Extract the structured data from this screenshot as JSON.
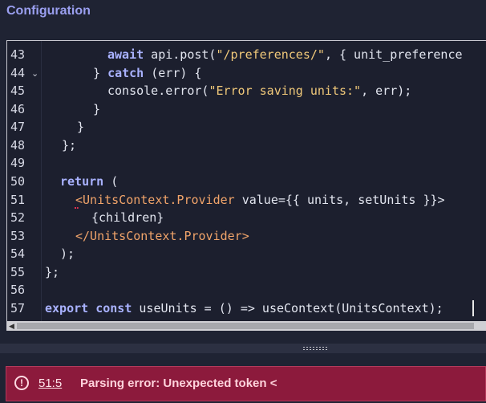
{
  "header": {
    "title": "Configuration"
  },
  "editor": {
    "line_numbers": [
      "43",
      "44",
      "45",
      "46",
      "47",
      "48",
      "49",
      "50",
      "51",
      "52",
      "53",
      "54",
      "55",
      "56",
      "57"
    ],
    "lines": {
      "l43": {
        "kw": "await",
        "rest": " api.post(",
        "str": "\"/preferences/\"",
        "rest2": ", { unit_preference"
      },
      "l44": {
        "pre": "} ",
        "kw": "catch",
        "rest": " (err) {"
      },
      "l45": {
        "rest": "console.error(",
        "str": "\"Error saving units:\"",
        "rest2": ", err);"
      },
      "l46": {
        "rest": "}"
      },
      "l47": {
        "rest": "}"
      },
      "l48": {
        "rest": "};"
      },
      "l50": {
        "kw": "return",
        "rest": " ("
      },
      "l51": {
        "tag": "<UnitsContext.Provider",
        "rest": " value={{ units, setUnits }}>"
      },
      "l52": {
        "rest": "{children}"
      },
      "l53": {
        "tag": "</UnitsContext.Provider>"
      },
      "l54": {
        "rest": ");"
      },
      "l55": {
        "rest": "};"
      },
      "l57": {
        "kw1": "export",
        "kw2": "const",
        "rest": " useUnits = () => useContext(UnitsContext);"
      }
    }
  },
  "error": {
    "icon": "!",
    "location": "51:5",
    "message": "Parsing error: Unexpected token <"
  },
  "colors": {
    "accent": "#9a9ff0",
    "error_bg": "#8c1a3c",
    "string": "#f1c97a",
    "keyword": "#a9b2ff"
  }
}
